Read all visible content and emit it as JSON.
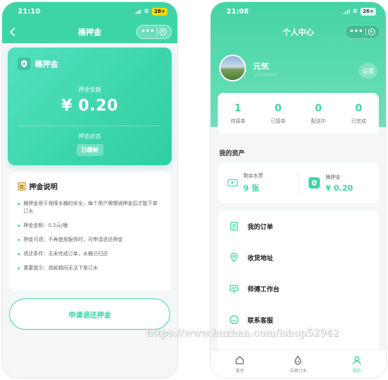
{
  "colors": {
    "accent": "#3ed5a6",
    "background": "#f4f6f7",
    "card": "#ffffff"
  },
  "left_screen": {
    "status_time": "21:10",
    "battery": "28+",
    "nav_title": "桶押金",
    "nav_capsule_dots": "•••",
    "deposit_card": {
      "title": "桶押金",
      "amount_label": "押金金额",
      "amount_value": "¥ 0.20",
      "status_label": "押金状态",
      "status_value": "已缴纳"
    },
    "info": {
      "title": "押金说明",
      "items": [
        "桶押金用于保障水桶的安全，每个用户需缴纳押金后才能下单订水",
        "押金金额：0.2元/桶",
        "押金可退：不再使用服务时，可申请退还押金",
        "退还条件：无未完成订单，水桶已归还",
        "重要提示：退款期间无法下单订水"
      ]
    },
    "refund_button": "申请退还押金"
  },
  "right_screen": {
    "status_time": "21:08",
    "battery": "26+",
    "nav_title": "个人中心",
    "nav_capsule_dots": "•••",
    "user": {
      "name": "元気",
      "phone": "1**********"
    },
    "settings_label": "设置",
    "order_stats": [
      {
        "count": "1",
        "label": "待接单"
      },
      {
        "count": "0",
        "label": "已接单"
      },
      {
        "count": "0",
        "label": "配送中"
      },
      {
        "count": "0",
        "label": "已完成"
      }
    ],
    "assets_title": "我的资产",
    "assets": {
      "tickets_label": "剩余水票",
      "tickets_value": "9 张",
      "deposit_label": "桶押金",
      "deposit_value": "¥ 0.20"
    },
    "menu": [
      {
        "label": "我的订单",
        "icon": "order-list-icon"
      },
      {
        "label": "收货地址",
        "icon": "location-pin-icon"
      },
      {
        "label": "师傅工作台",
        "icon": "monitor-icon"
      },
      {
        "label": "联系客服",
        "icon": "chat-icon"
      }
    ],
    "tabs": [
      {
        "label": "首页",
        "icon": "home-icon"
      },
      {
        "label": "立即订水",
        "icon": "water-drop-icon"
      },
      {
        "label": "我的",
        "icon": "user-icon"
      }
    ]
  },
  "watermark": "https://www.huzhan.com/ishop52942"
}
